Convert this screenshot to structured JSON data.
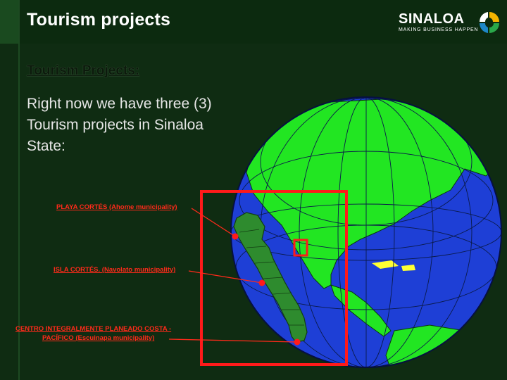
{
  "header": {
    "title": "Tourism projects"
  },
  "logo": {
    "brand": "SINALOA",
    "tagline": "MAKING BUSINESS HAPPEN"
  },
  "content": {
    "heading": "Tourism Projects:",
    "paragraph": "Right now we have three (3) Tourism projects in Sinaloa State:"
  },
  "projects": [
    {
      "label": "PLAYA CORTÉS (Ahome municipality)"
    },
    {
      "label": "ISLA CORTÉS. (Navolato municipality)"
    },
    {
      "label_line1": "CENTRO INTEGRALMENTE PLANEADO COSTA -",
      "label_line2": "PACÍFICO (Escuinapa municipality)"
    }
  ],
  "colors": {
    "background": "#0f2c12",
    "ocean": "#1e3fd6",
    "land": "#22e622",
    "sinaloa_map": "#2e8b2e",
    "highlight": "#ff1a1a"
  }
}
